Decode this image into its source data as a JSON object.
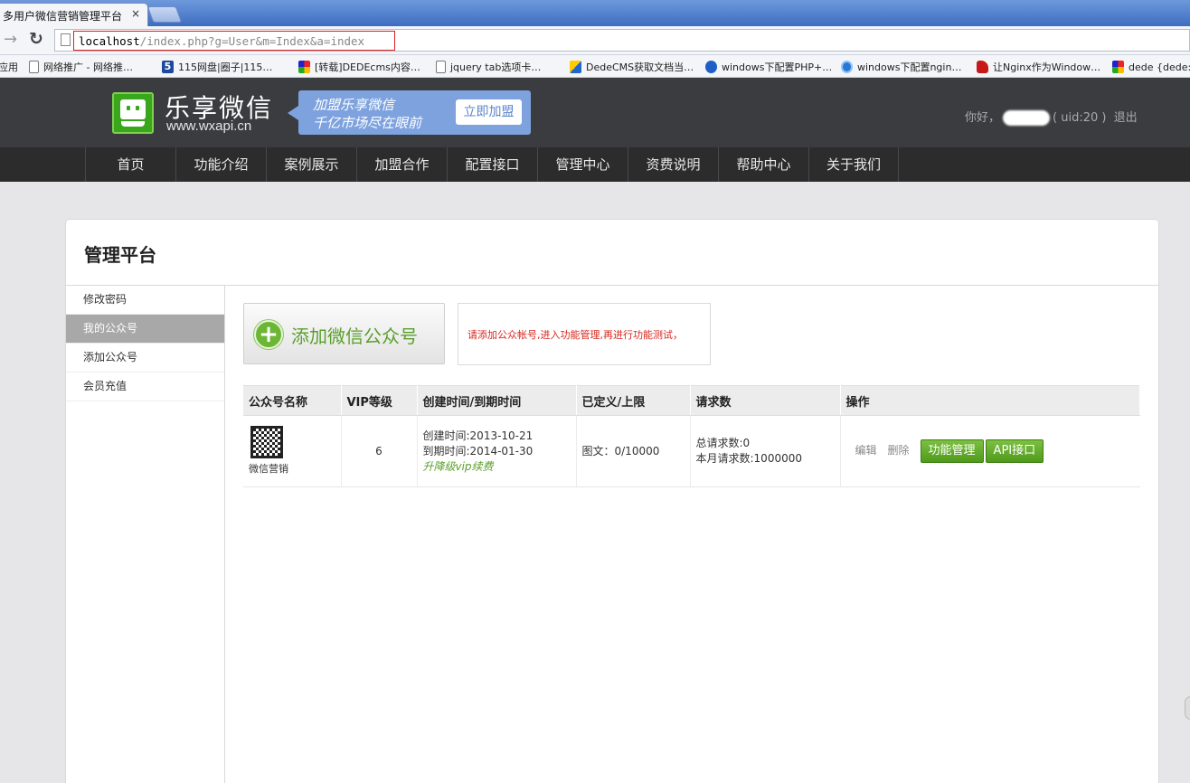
{
  "browser": {
    "tab_title": "多用户微信营销管理平台",
    "tab_close": "×",
    "url_host": "localhost",
    "url_rest": "/index.php?g=User&m=Index&a=index",
    "bookmarks": [
      {
        "label": "应用",
        "icon": "apps-icon"
      },
      {
        "label": "网络推广 - 网络推…",
        "icon": "page-icon"
      },
      {
        "label": "115网盘|圈子|115…",
        "icon": "115-icon"
      },
      {
        "label": "[转载]DEDEcms内容…",
        "icon": "dede-icon"
      },
      {
        "label": "jquery tab选项卡…",
        "icon": "page-icon"
      },
      {
        "label": "DedeCMS获取文档当…",
        "icon": "cms-icon"
      },
      {
        "label": "windows下配置PHP+…",
        "icon": "blog-icon"
      },
      {
        "label": "windows下配置ngin…",
        "icon": "ie-icon"
      },
      {
        "label": "让Nginx作为Window…",
        "icon": "redhat-icon"
      },
      {
        "label": "dede {dede:…",
        "icon": "dede-icon"
      }
    ]
  },
  "header": {
    "brand_cn": "乐享微信",
    "brand_en": "www.wxapi.cn",
    "promo_line1": "加盟乐享微信",
    "promo_line2": "千亿市场尽在眼前",
    "promo_button": "立即加盟",
    "greeting": "你好，",
    "uid_text": "( uid:20 )",
    "logout": "退出"
  },
  "nav": [
    "首页",
    "功能介绍",
    "案例展示",
    "加盟合作",
    "配置接口",
    "管理中心",
    "资费说明",
    "帮助中心",
    "关于我们"
  ],
  "panel": {
    "title": "管理平台",
    "sidebar": [
      "修改密码",
      "我的公众号",
      "添加公众号",
      "会员充值"
    ],
    "active_index": 1,
    "add_button": "添加微信公众号",
    "notice": "请添加公众帐号,进入功能管理,再进行功能测试，"
  },
  "table": {
    "headers": [
      "公众号名称",
      "VIP等级",
      "创建时间/到期时间",
      "已定义/上限",
      "请求数",
      "操作"
    ],
    "rows": [
      {
        "name": "微信营销",
        "vip": "6",
        "created": "创建时间:2013-10-21",
        "expires": "到期时间:2014-01-30",
        "upgrade": "升降级vip续费",
        "quota": "图文：0/10000",
        "total_requests": "总请求数:0",
        "month_requests": "本月请求数:1000000",
        "edit": "编辑",
        "delete": "删除",
        "manage": "功能管理",
        "api": "API接口"
      }
    ]
  },
  "colors": {
    "header_bg": "#3b3c3f",
    "nav_bg": "#2c2c2d",
    "brand_green": "#3aa61b",
    "promo_blue": "#7da2de",
    "notice_red": "#d6261e",
    "button_green": "#5aa02a"
  }
}
